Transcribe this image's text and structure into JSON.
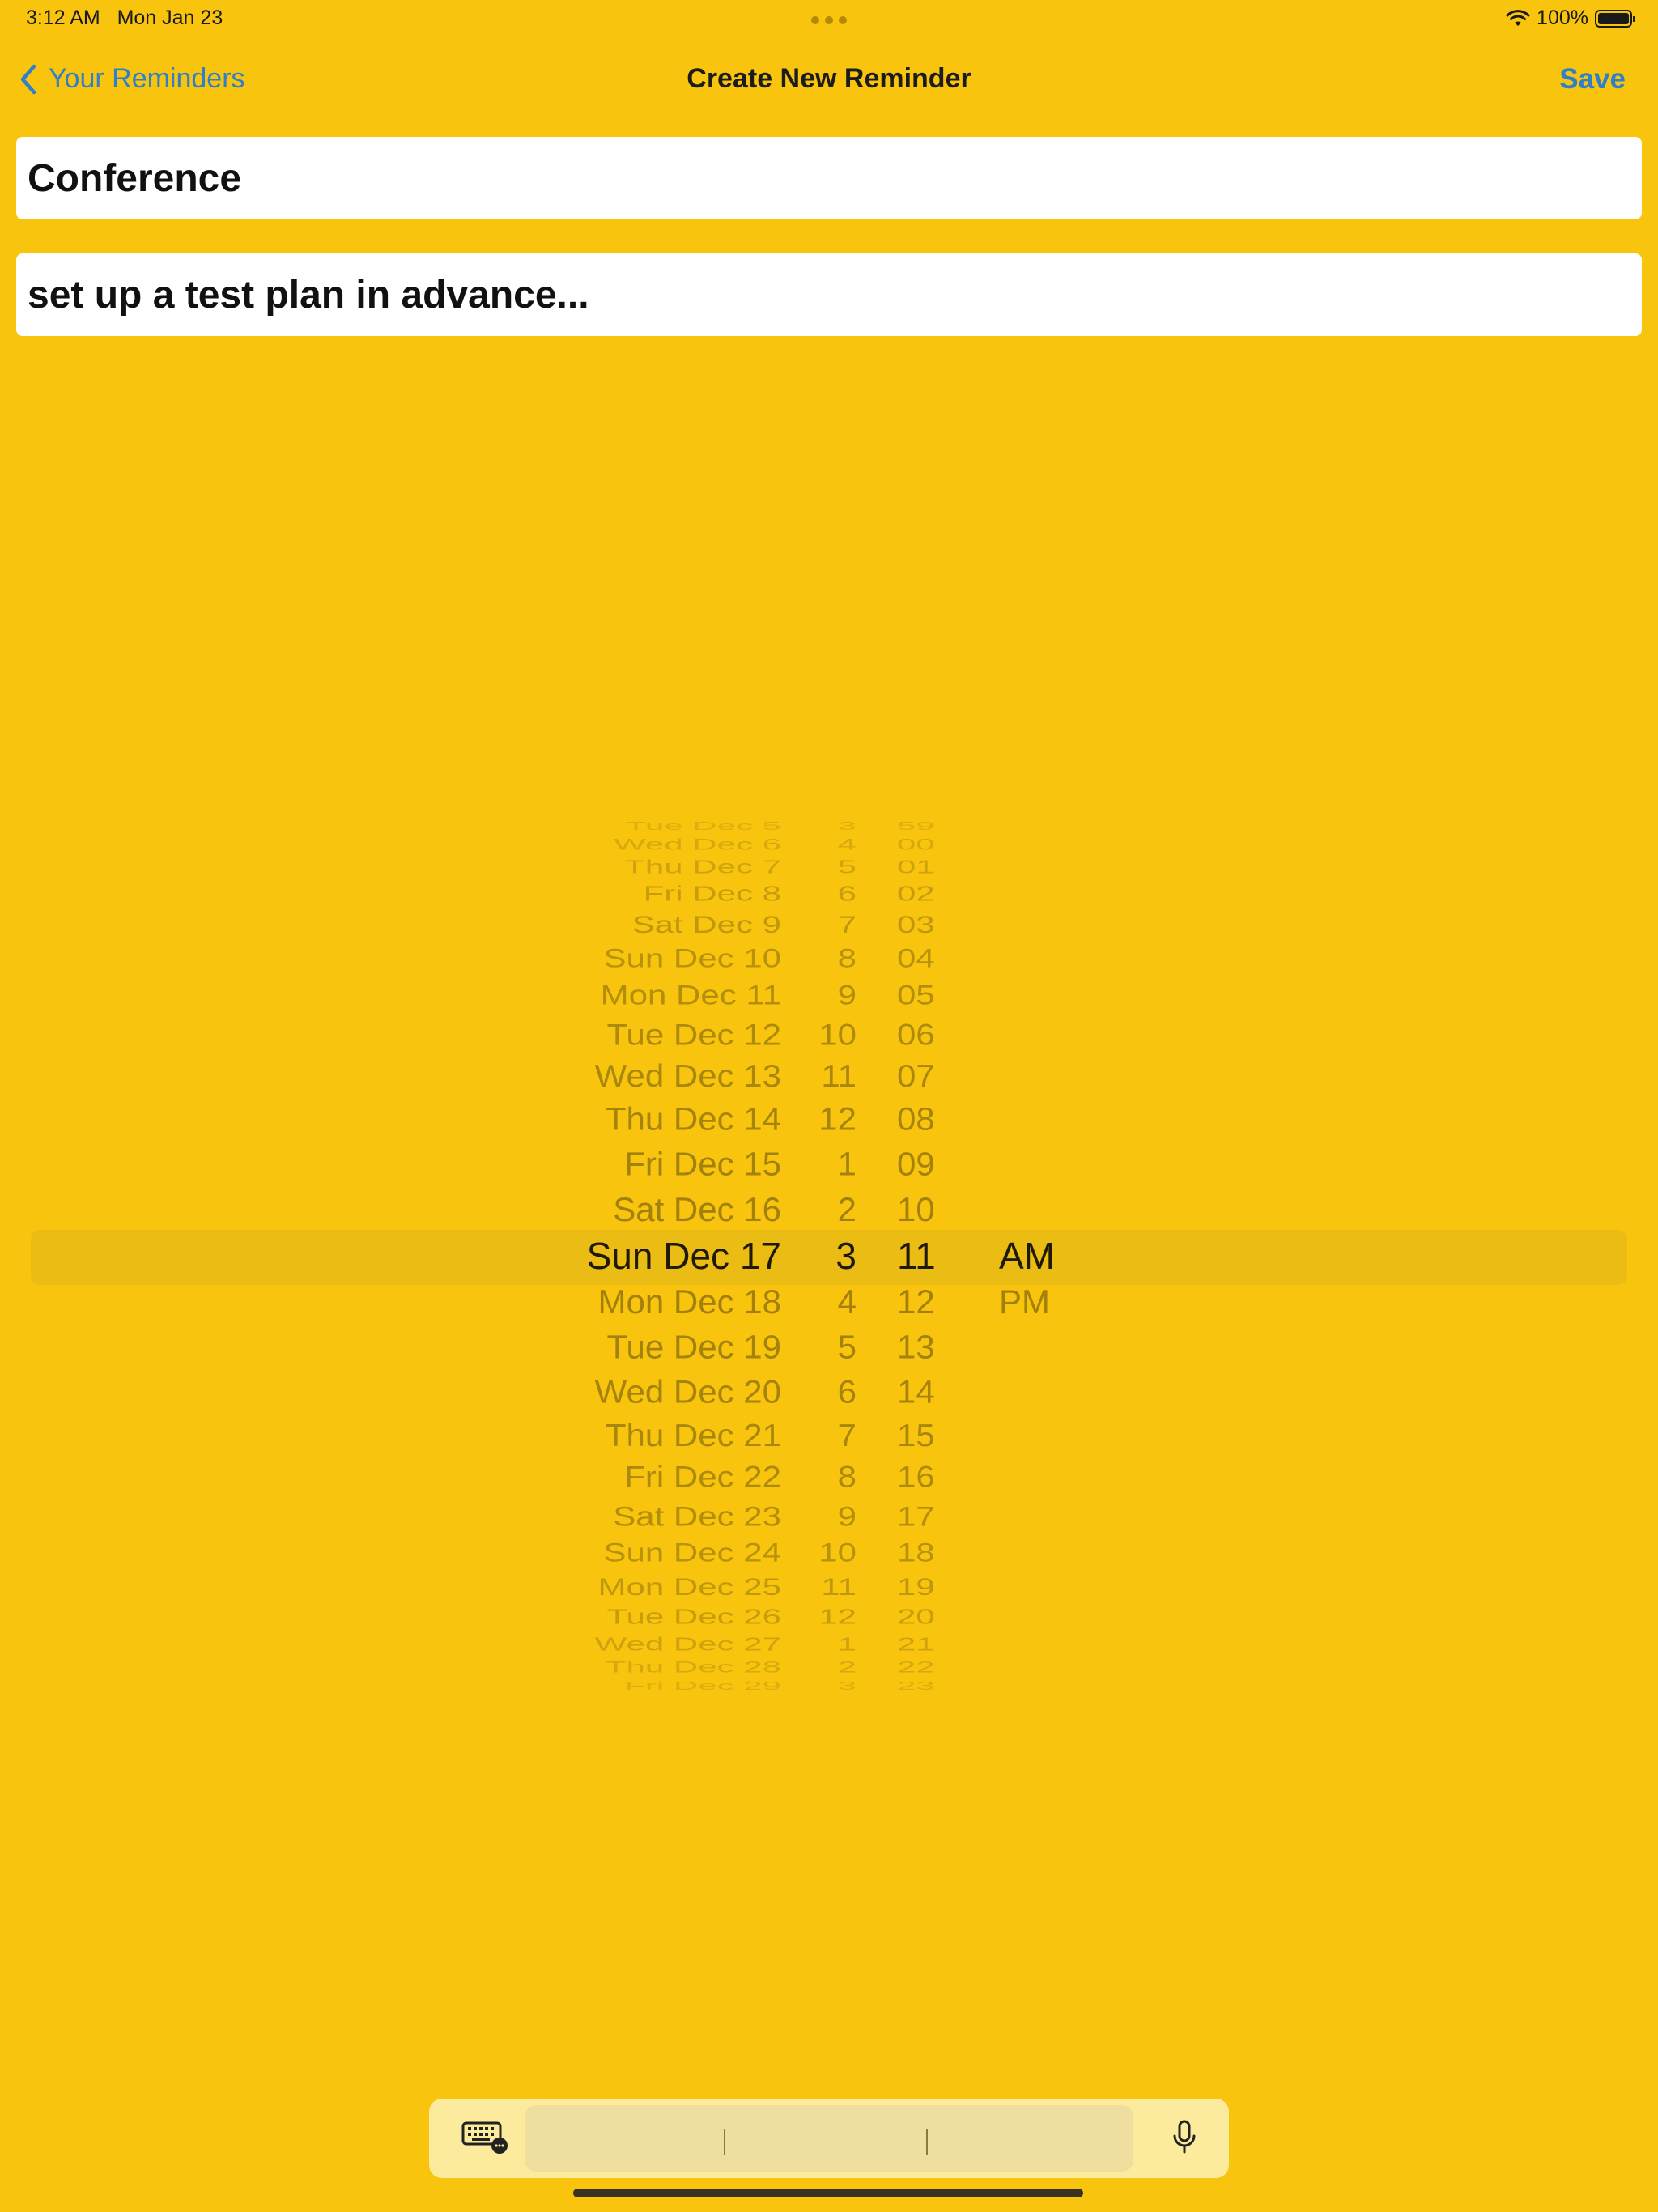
{
  "status_bar": {
    "time": "3:12 AM",
    "date": "Mon Jan 23",
    "battery": "100%"
  },
  "nav": {
    "back_label": "Your Reminders",
    "title": "Create New Reminder",
    "save_label": "Save"
  },
  "form": {
    "title_value": "Conference",
    "notes_value": "set up a test plan in advance..."
  },
  "picker": {
    "dates": [
      "Tue Dec 5",
      "Wed Dec 6",
      "Thu Dec 7",
      "Fri Dec 8",
      "Sat Dec 9",
      "Sun Dec 10",
      "Mon Dec 11",
      "Tue Dec 12",
      "Wed Dec 13",
      "Thu Dec 14",
      "Fri Dec 15",
      "Sat Dec 16",
      "Sun Dec 17",
      "Mon Dec 18",
      "Tue Dec 19",
      "Wed Dec 20",
      "Thu Dec 21",
      "Fri Dec 22",
      "Sat Dec 23",
      "Sun Dec 24",
      "Mon Dec 25",
      "Tue Dec 26",
      "Wed Dec 27",
      "Thu Dec 28",
      "Fri Dec 29"
    ],
    "hours": [
      "3",
      "4",
      "5",
      "6",
      "7",
      "8",
      "9",
      "10",
      "11",
      "12",
      "1",
      "2",
      "3",
      "4",
      "5",
      "6",
      "7",
      "8",
      "9",
      "10",
      "11",
      "12",
      "1",
      "2",
      "3"
    ],
    "minutes": [
      "59",
      "00",
      "01",
      "02",
      "03",
      "04",
      "05",
      "06",
      "07",
      "08",
      "09",
      "10",
      "11",
      "12",
      "13",
      "14",
      "15",
      "16",
      "17",
      "18",
      "19",
      "20",
      "21",
      "22",
      "23"
    ],
    "ampm": [
      "AM",
      "PM"
    ],
    "selected_index": 12,
    "selected": {
      "date": "Sun Dec 17",
      "hour": "3",
      "minute": "11",
      "ampm": "AM"
    }
  },
  "colors": {
    "background": "#F8C40E",
    "accent": "#2F80C8",
    "selection_band": "#EBBD14"
  },
  "toolbar": {
    "keyboard_icon": "keyboard-icon",
    "mic_icon": "microphone-icon"
  }
}
